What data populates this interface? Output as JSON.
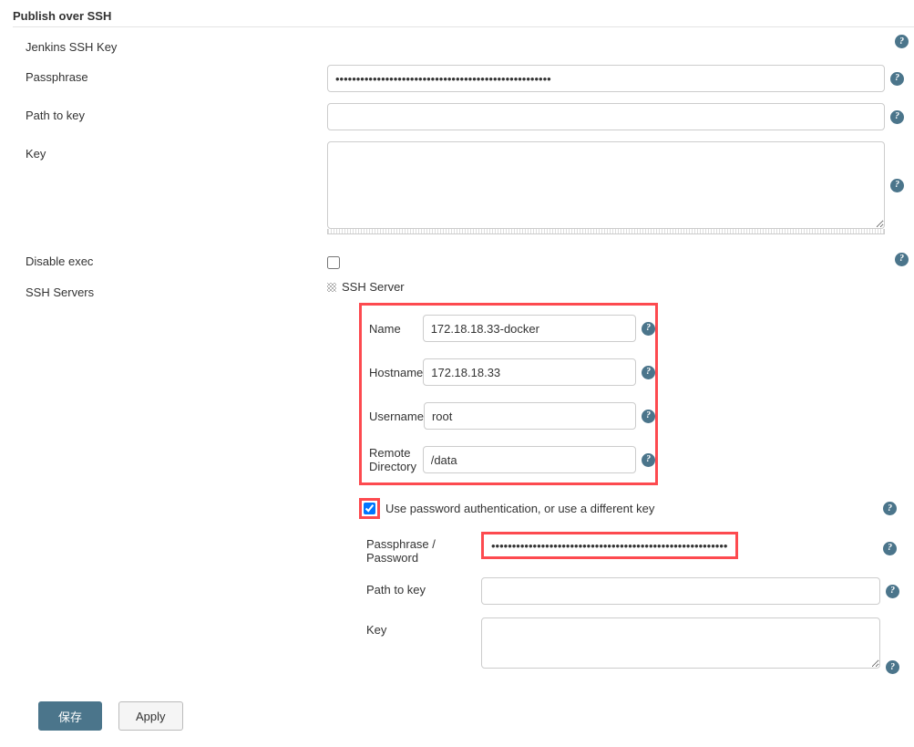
{
  "section": {
    "title": "Publish over SSH"
  },
  "jenkinsKey": {
    "label": "Jenkins SSH Key"
  },
  "passphrase": {
    "label": "Passphrase",
    "value": "••••••••••••••••••••••••••••••••••••••••••••••••••••"
  },
  "pathToKey": {
    "label": "Path to key",
    "value": ""
  },
  "key": {
    "label": "Key",
    "value": ""
  },
  "disableExec": {
    "label": "Disable exec",
    "checked": false
  },
  "sshServersLabel": "SSH Servers",
  "sshServerTitle": "SSH Server",
  "server": {
    "name": {
      "label": "Name",
      "value": "172.18.18.33-docker"
    },
    "hostname": {
      "label": "Hostname",
      "value": "172.18.18.33"
    },
    "username": {
      "label": "Username",
      "value": "root"
    },
    "remoteDir": {
      "label": "Remote Directory",
      "value": "/data"
    }
  },
  "auth": {
    "label": "Use password authentication, or use a different key",
    "checked": true,
    "passphrase": {
      "label": "Passphrase / Password",
      "value": "•••••••••••••••••••••••••••••••••••••••••••••••••••••••••••"
    },
    "pathToKey": {
      "label": "Path to key",
      "value": ""
    },
    "key": {
      "label": "Key",
      "value": ""
    }
  },
  "buttons": {
    "save": "保存",
    "apply": "Apply"
  },
  "helpGlyph": "?"
}
